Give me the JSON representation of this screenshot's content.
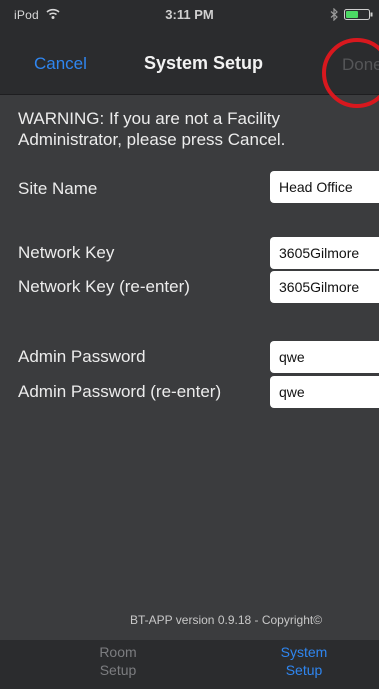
{
  "status_bar": {
    "carrier": "iPod",
    "time": "3:11 PM",
    "battery_color": "#4cd964"
  },
  "nav": {
    "cancel_label": "Cancel",
    "title": "System Setup",
    "done_label": "Done"
  },
  "warning": "WARNING: If you are not a Facility Administrator, please press Cancel.",
  "fields": {
    "site_name": {
      "label": "Site Name",
      "value": "Head Office"
    },
    "network_key": {
      "label": "Network Key",
      "value": "3605Gilmore"
    },
    "network_key_reenter": {
      "label": "Network Key (re-enter)",
      "value": "3605Gilmore"
    },
    "admin_password": {
      "label": "Admin Password",
      "value": "qwe"
    },
    "admin_password_reenter": {
      "label": "Admin Password (re-enter)",
      "value": "qwe"
    }
  },
  "footer": "BT-APP version 0.9.18 - Copyright©",
  "tabs": {
    "room_setup": {
      "line1": "Room",
      "line2": "Setup"
    },
    "system_setup": {
      "line1": "System",
      "line2": "Setup"
    }
  },
  "colors": {
    "accent": "#2f86f0",
    "highlight_circle": "#d8181e",
    "background": "#3b3c3e",
    "bar": "#2b2c2e"
  }
}
